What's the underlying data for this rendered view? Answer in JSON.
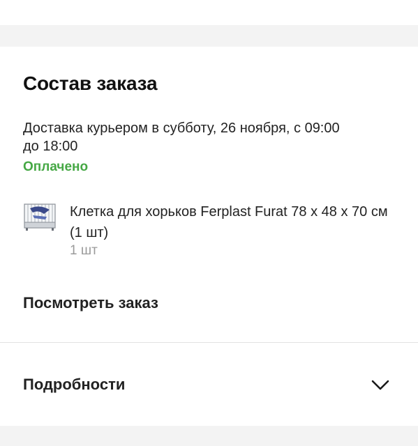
{
  "order": {
    "title": "Состав заказа",
    "delivery_text": "Доставка курьером в субботу, 26 ноября, с 09:00 до 18:00",
    "payment_status": "Оплачено",
    "payment_status_color": "#46a845",
    "items": [
      {
        "name": "Клетка для хорьков Ferplast Furat 78 x 48 x 70 см (1 шт)",
        "quantity": "1 шт",
        "thumbnail_icon": "cage-thumbnail"
      }
    ],
    "view_order_label": "Посмотреть заказ"
  },
  "details": {
    "label": "Подробности",
    "toggle_icon": "chevron-down-icon"
  }
}
